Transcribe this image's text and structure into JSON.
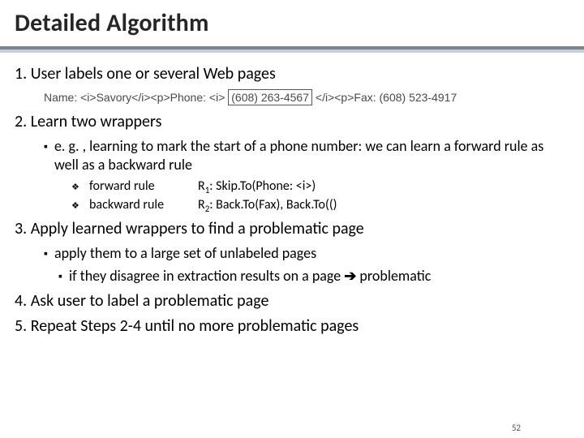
{
  "title": "Detailed Algorithm",
  "steps": {
    "s1": "1. User labels one or several Web pages",
    "example_pre": "Name: <i>Savory</i><p>Phone: <i>",
    "example_box": "(608) 263-4567",
    "example_post": "</i><p>Fax: (608) 523-4917",
    "s2": "2. Learn two wrappers",
    "s2_sub": "e. g. , learning to mark the start of a phone number: we can learn a forward rule as well as a backward rule",
    "r1_label": "forward rule",
    "r1_val_pre": "R",
    "r1_val_sub": "1",
    "r1_val_post": ": Skip.To(Phone: <i>)",
    "r2_label": "backward rule",
    "r2_val_pre": "R",
    "r2_val_sub": "2",
    "r2_val_post": ": Back.To(Fax), Back.To(()",
    "s3": "3. Apply learned wrappers to find a problematic page",
    "s3_sub1": "apply them to a large set of unlabeled pages",
    "s3_sub2_a": "if they disagree in extraction results on a page ",
    "arrow": "➔",
    "s3_sub2_b": " problematic",
    "s4": "4. Ask user to label a problematic page",
    "s5": "5. Repeat Steps 2-4 until no more problematic pages"
  },
  "pagenum": "52"
}
